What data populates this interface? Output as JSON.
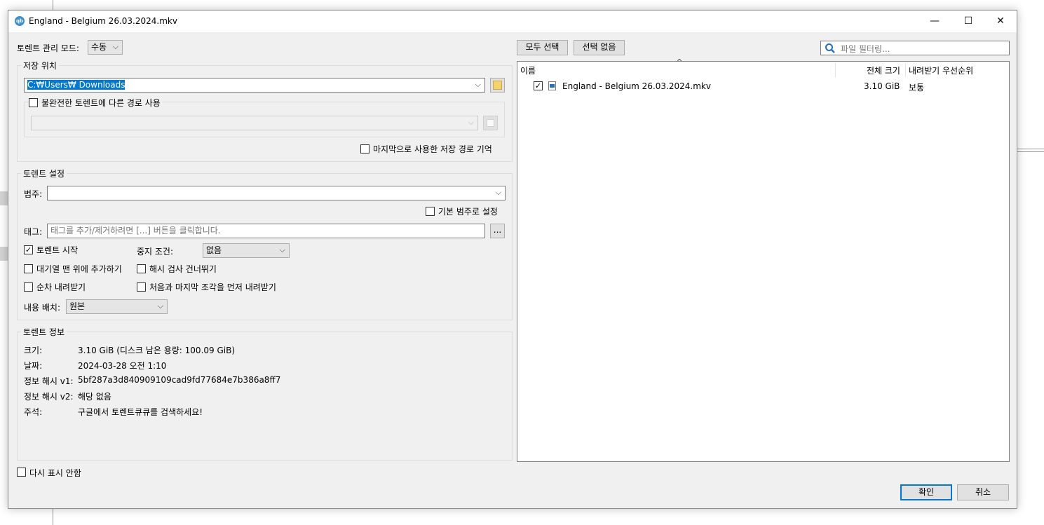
{
  "window": {
    "title": "England - Belgium 26.03.2024.mkv",
    "app_icon": "qb",
    "controls": {
      "minimize": "—",
      "maximize": "☐",
      "close": "✕"
    }
  },
  "mgmt_mode": {
    "label": "토렌트 관리 모드:",
    "value": "수동"
  },
  "save_location": {
    "group_title": "저장 위치",
    "path": "C:₩Users₩     Downloads",
    "alt_path_label": "불완전한 토렌트에 다른 경로 사용",
    "alt_path_checked": false,
    "alt_path_value": "",
    "remember_label": "마지막으로 사용한 저장 경로 기억",
    "remember_checked": false
  },
  "torrent_settings": {
    "group_title": "토렌트 설정",
    "category_label": "범주:",
    "category_value": "",
    "default_category_label": "기본 범주로 설정",
    "default_category_checked": false,
    "tags_label": "태그:",
    "tags_placeholder": "태그를 추가/제거하려면 [...] 버튼을 클릭합니다.",
    "tags_button": "...",
    "start_torrent_label": "토렌트 시작",
    "start_torrent_checked": true,
    "stop_condition_label": "중지 조건:",
    "stop_condition_value": "없음",
    "add_top_queue_label": "대기열 맨 위에 추가하기",
    "add_top_queue_checked": false,
    "skip_hash_label": "해시 검사 건너뛰기",
    "skip_hash_checked": false,
    "sequential_label": "순차 내려받기",
    "sequential_checked": false,
    "first_last_label": "처음과 마지막 조각을 먼저 내려받기",
    "first_last_checked": false,
    "layout_label": "내용 배치:",
    "layout_value": "원본"
  },
  "torrent_info": {
    "group_title": "토렌트 정보",
    "rows": [
      {
        "label": "크기:",
        "value": "3.10 GiB (디스크 남은 용량: 100.09 GiB)"
      },
      {
        "label": "날짜:",
        "value": "2024-03-28 오전 1:10"
      },
      {
        "label": "정보 해시 v1:",
        "value": "5bf287a3d840909109cad9fd77684e7b386a8ff7"
      },
      {
        "label": "정보 해시 v2:",
        "value": "해당 없음"
      },
      {
        "label": "주석:",
        "value": "구글에서 토렌트큐큐를 검색하세요!"
      }
    ]
  },
  "file_panel": {
    "select_all": "모두 선택",
    "select_none": "선택 없음",
    "filter_placeholder": "파일 필터링...",
    "columns": {
      "name": "이름",
      "size": "전체 크기",
      "priority": "내려받기 우선순위"
    },
    "sort_indicator": "^",
    "files": [
      {
        "name": "England - Belgium 26.03.2024.mkv",
        "size": "3.10 GiB",
        "priority": "보통",
        "checked": true
      }
    ]
  },
  "footer": {
    "dont_show_label": "다시 표시 안함",
    "dont_show_checked": false,
    "ok": "확인",
    "cancel": "취소"
  },
  "colors": {
    "accent": "#0078d7",
    "window_bg": "#f0f0f0",
    "folder_icon": "#f5d36a",
    "search_icon": "#1f6fc5"
  }
}
